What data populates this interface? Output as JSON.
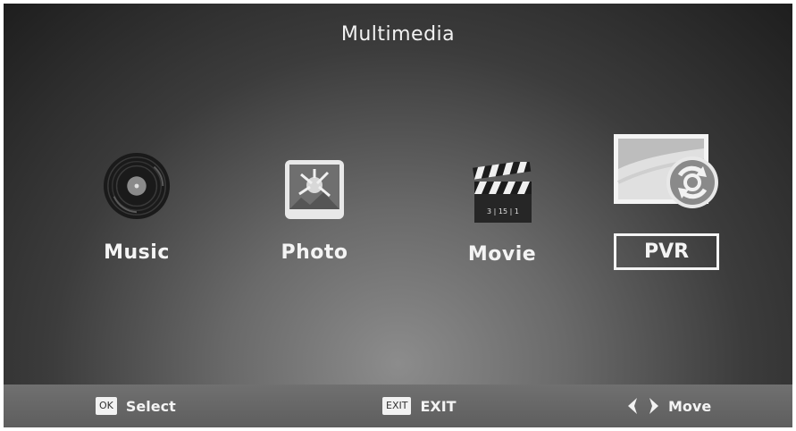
{
  "title": "Multimedia",
  "menu": {
    "items": [
      {
        "label": "Music",
        "icon": "vinyl-record-icon"
      },
      {
        "label": "Photo",
        "icon": "photo-icon"
      },
      {
        "label": "Movie",
        "icon": "clapperboard-icon"
      },
      {
        "label": "PVR",
        "icon": "pvr-record-icon"
      }
    ],
    "selected": "PVR",
    "clapperboard_text": "3 | 15 | 1"
  },
  "footer": {
    "select_key": "OK",
    "select_label": "Select",
    "exit_key": "EXIT",
    "exit_label": "EXIT",
    "move_label": "Move"
  },
  "colors": {
    "text": "#f4f4f4",
    "footer_bg": "#676767"
  }
}
